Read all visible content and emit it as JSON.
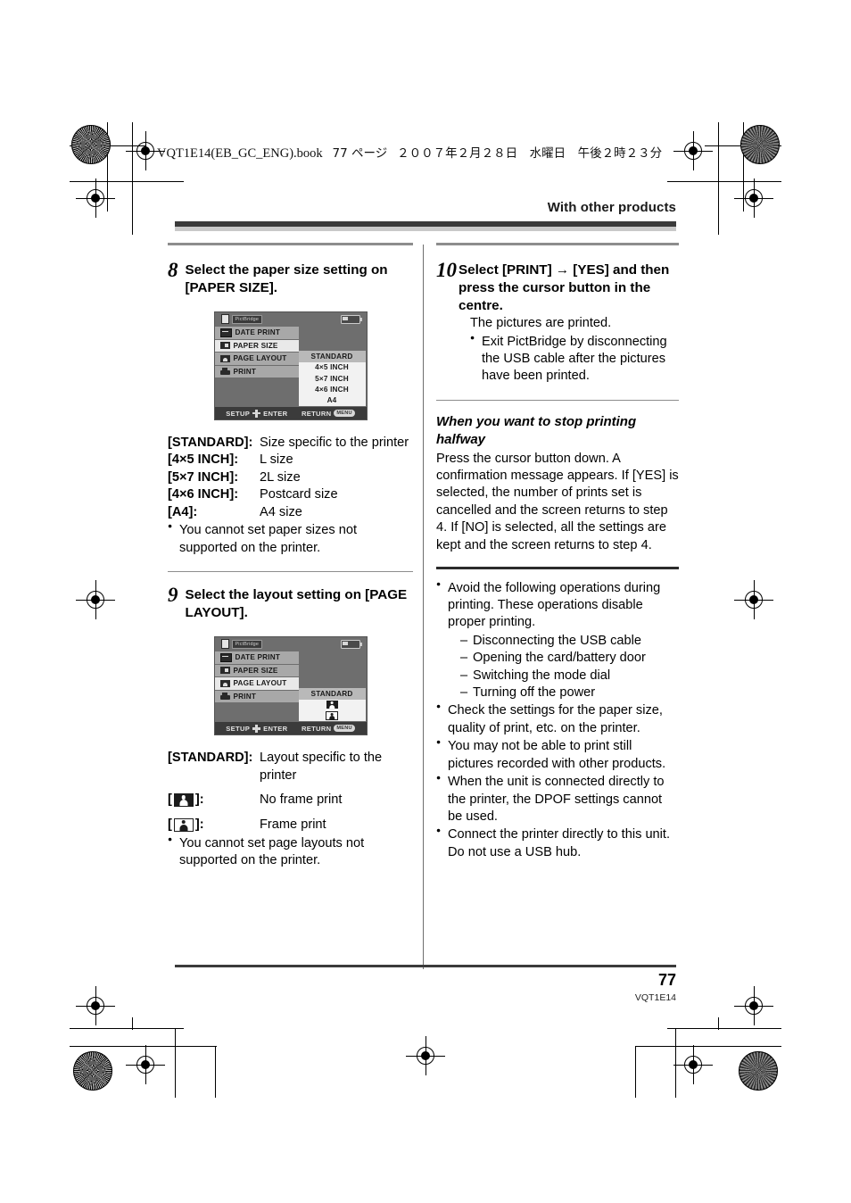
{
  "header": {
    "book_line_ascii": "VQT1E14(EB_GC_ENG).book",
    "book_line_page": "77 ページ",
    "book_line_date": "２００７年２月２８日　水曜日　午後２時２３分",
    "running_head": "With other products"
  },
  "left_column": {
    "step8": {
      "number": "8",
      "title": "Select the paper size setting on [PAPER SIZE].",
      "lcd": {
        "badge_label": "PictBridge",
        "menu": [
          {
            "label": "DATE PRINT",
            "icon": "date-print-icon",
            "selected": false
          },
          {
            "label": "PAPER SIZE",
            "icon": "paper-size-icon",
            "selected": true
          },
          {
            "label": "PAGE LAYOUT",
            "icon": "page-layout-icon",
            "selected": false
          },
          {
            "label": "PRINT",
            "icon": "print-icon",
            "selected": false
          }
        ],
        "options": [
          {
            "label": "STANDARD",
            "highlighted": true
          },
          {
            "label": "4×5 INCH",
            "highlighted": false
          },
          {
            "label": "5×7 INCH",
            "highlighted": false
          },
          {
            "label": "4×6 INCH",
            "highlighted": false
          },
          {
            "label": "A4",
            "highlighted": false
          }
        ],
        "bottom_setup": "SETUP",
        "bottom_enter": "ENTER",
        "bottom_return": "RETURN",
        "bottom_menu_chip": "MENU"
      },
      "definitions": [
        {
          "term": "[STANDARD]:",
          "desc": "Size specific to the printer"
        },
        {
          "term": "[4×5 INCH]:",
          "desc": "L size"
        },
        {
          "term": "[5×7 INCH]:",
          "desc": "2L size"
        },
        {
          "term": "[4×6 INCH]:",
          "desc": "Postcard size"
        },
        {
          "term": "[A4]:",
          "desc": "A4 size"
        }
      ],
      "note": "You cannot set paper sizes not supported on the printer."
    },
    "step9": {
      "number": "9",
      "title": "Select the layout setting on [PAGE LAYOUT].",
      "lcd": {
        "badge_label": "PictBridge",
        "menu": [
          {
            "label": "DATE PRINT",
            "icon": "date-print-icon",
            "selected": false
          },
          {
            "label": "PAPER SIZE",
            "icon": "paper-size-icon",
            "selected": false
          },
          {
            "label": "PAGE LAYOUT",
            "icon": "page-layout-icon",
            "selected": true
          },
          {
            "label": "PRINT",
            "icon": "print-icon",
            "selected": false
          }
        ],
        "options": [
          {
            "label": "STANDARD",
            "highlighted": true
          },
          {
            "label": "",
            "icon": "no-frame-print-icon",
            "highlighted": false
          },
          {
            "label": "",
            "icon": "frame-print-icon",
            "highlighted": false
          }
        ],
        "bottom_setup": "SETUP",
        "bottom_enter": "ENTER",
        "bottom_return": "RETURN",
        "bottom_menu_chip": "MENU"
      },
      "definitions": [
        {
          "term": "[STANDARD]:",
          "desc": "Layout specific to the printer"
        }
      ],
      "icon_definitions": [
        {
          "icon": "no-frame-print-icon",
          "desc": "No frame print"
        },
        {
          "icon": "frame-print-icon",
          "desc": "Frame print"
        }
      ],
      "note": "You cannot set page layouts not supported on the printer."
    }
  },
  "right_column": {
    "step10": {
      "number": "10",
      "title": "Select [PRINT] → [YES] and then press the cursor button in the centre.",
      "body": "The pictures are printed.",
      "note": "Exit PictBridge by disconnecting the USB cable after the pictures have been printed."
    },
    "stop_section": {
      "heading": "When you want to stop printing halfway",
      "paragraph": "Press the cursor button down. A confirmation message appears. If [YES] is selected, the number of prints set is cancelled and the screen returns to step 4. If [NO] is selected, all the settings are kept and the screen returns to step 4."
    },
    "cautions": [
      {
        "text": "Avoid the following operations during printing. These operations disable proper printing.",
        "sub": [
          "Disconnecting the USB cable",
          "Opening the card/battery door",
          "Switching the mode dial",
          "Turning off the power"
        ]
      },
      {
        "text": "Check the settings for the paper size, quality of print, etc. on the printer.",
        "sub": []
      },
      {
        "text": "You may not be able to print still pictures recorded with other products.",
        "sub": []
      },
      {
        "text": "When the unit is connected directly to the printer, the DPOF settings cannot be used.",
        "sub": []
      },
      {
        "text": "Connect the printer directly to this unit. Do not use a USB hub.",
        "sub": []
      }
    ]
  },
  "footer": {
    "page_number": "77",
    "doc_code": "VQT1E14"
  }
}
